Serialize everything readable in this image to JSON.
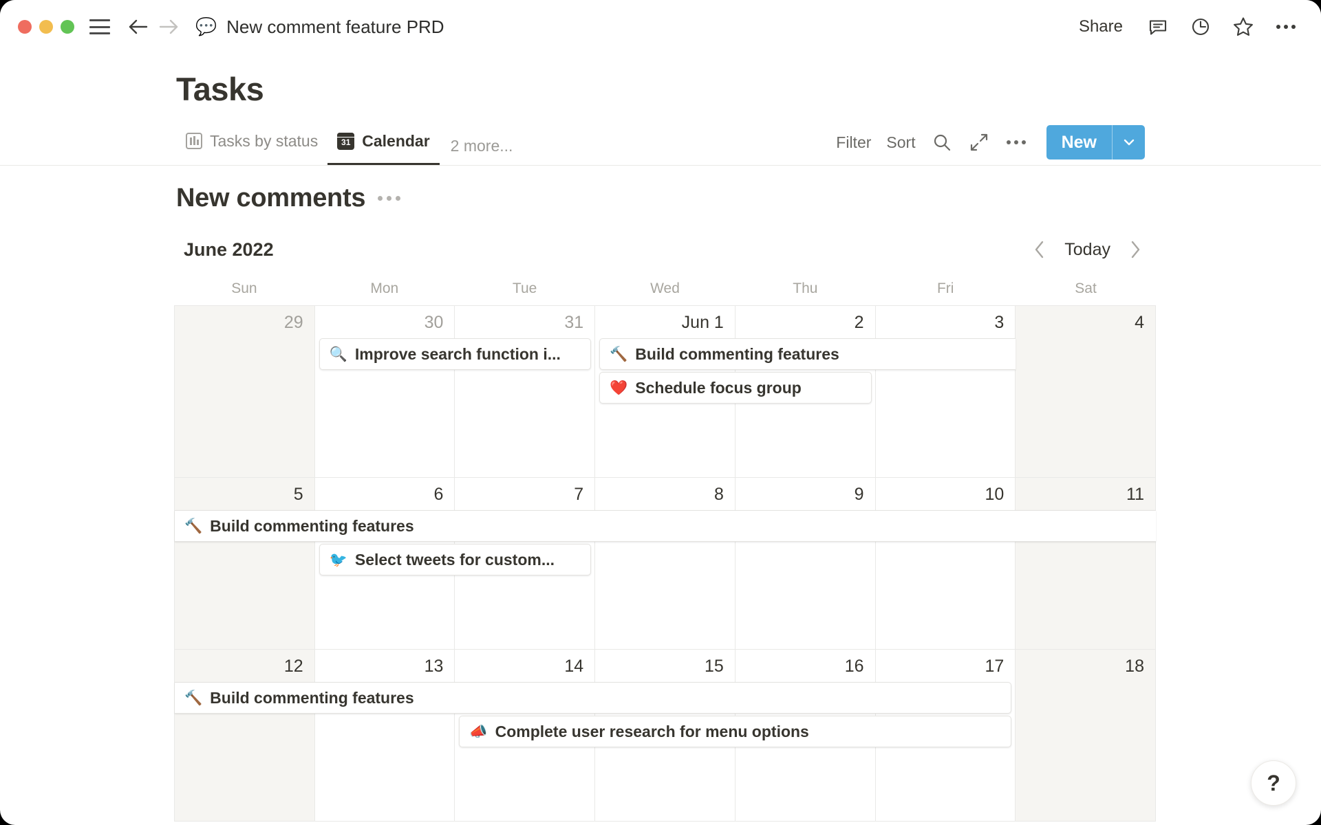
{
  "window": {
    "traffic_lights": [
      "close",
      "minimize",
      "maximize"
    ],
    "doc_emoji": "💬",
    "doc_title": "New comment feature PRD",
    "share_label": "Share",
    "icons": [
      "comment-icon",
      "history-clock-icon",
      "star-icon",
      "more-menu-icon"
    ]
  },
  "page": {
    "title": "Tasks"
  },
  "view_tabs": {
    "items": [
      {
        "label": "Tasks by status",
        "icon": "board-icon",
        "active": false
      },
      {
        "label": "Calendar",
        "icon": "calendar-31-icon",
        "active": true
      }
    ],
    "more_label": "2 more...",
    "actions": {
      "filter_label": "Filter",
      "sort_label": "Sort",
      "search_icon": "search-icon",
      "expand_icon": "expand-arrows-icon",
      "more_icon": "more-menu-icon",
      "new_label": "New",
      "new_caret_icon": "chevron-down-icon",
      "new_color": "#4fa8dd"
    }
  },
  "database": {
    "title": "New comments",
    "menu_icon": "more-menu-icon"
  },
  "calendar": {
    "month_label": "June 2022",
    "prev_icon": "chevron-left-icon",
    "today_label": "Today",
    "next_icon": "chevron-right-icon",
    "weekdays": [
      "Sun",
      "Mon",
      "Tue",
      "Wed",
      "Thu",
      "Fri",
      "Sat"
    ],
    "weeks": [
      {
        "days": [
          {
            "num": "29",
            "muted": true,
            "weekend": true
          },
          {
            "num": "30",
            "muted": true,
            "weekend": false
          },
          {
            "num": "31",
            "muted": true,
            "weekend": false
          },
          {
            "num": "Jun 1",
            "muted": false,
            "weekend": false
          },
          {
            "num": "2",
            "muted": false,
            "weekend": false
          },
          {
            "num": "3",
            "muted": false,
            "weekend": false
          },
          {
            "num": "4",
            "muted": false,
            "weekend": true
          }
        ],
        "events": [
          {
            "emoji": "🔍",
            "label": "Improve search function i...",
            "start": 1,
            "span": 2,
            "row": 0,
            "clipped_left": false,
            "clipped_right": false
          },
          {
            "emoji": "🔨",
            "label": "Build commenting features",
            "start": 3,
            "span": 3,
            "row": 0,
            "clipped_left": false,
            "clipped_right": true
          },
          {
            "emoji": "❤️",
            "label": "Schedule focus group",
            "start": 3,
            "span": 2,
            "row": 1,
            "clipped_left": false,
            "clipped_right": false
          }
        ]
      },
      {
        "days": [
          {
            "num": "5",
            "muted": false,
            "weekend": true
          },
          {
            "num": "6",
            "muted": false,
            "weekend": false
          },
          {
            "num": "7",
            "muted": false,
            "weekend": false
          },
          {
            "num": "8",
            "muted": false,
            "weekend": false
          },
          {
            "num": "9",
            "muted": false,
            "weekend": false
          },
          {
            "num": "10",
            "muted": false,
            "weekend": false
          },
          {
            "num": "11",
            "muted": false,
            "weekend": true
          }
        ],
        "events": [
          {
            "emoji": "🔨",
            "label": "Build commenting features",
            "start": 0,
            "span": 7,
            "row": 0,
            "clipped_left": true,
            "clipped_right": true
          },
          {
            "emoji": "🐦",
            "label": "Select tweets for custom...",
            "start": 1,
            "span": 2,
            "row": 1,
            "clipped_left": false,
            "clipped_right": false
          }
        ]
      },
      {
        "days": [
          {
            "num": "12",
            "muted": false,
            "weekend": true
          },
          {
            "num": "13",
            "muted": false,
            "weekend": false
          },
          {
            "num": "14",
            "muted": false,
            "weekend": false
          },
          {
            "num": "15",
            "muted": false,
            "weekend": false
          },
          {
            "num": "16",
            "muted": false,
            "weekend": false
          },
          {
            "num": "17",
            "muted": false,
            "weekend": false
          },
          {
            "num": "18",
            "muted": false,
            "weekend": true
          }
        ],
        "events": [
          {
            "emoji": "🔨",
            "label": "Build commenting features",
            "start": 0,
            "span": 6,
            "row": 0,
            "clipped_left": true,
            "clipped_right": false
          },
          {
            "emoji": "📣",
            "label": "Complete user research for menu options",
            "start": 2,
            "span": 4,
            "row": 1,
            "clipped_left": false,
            "clipped_right": false
          }
        ]
      }
    ]
  },
  "help": {
    "label": "?"
  }
}
